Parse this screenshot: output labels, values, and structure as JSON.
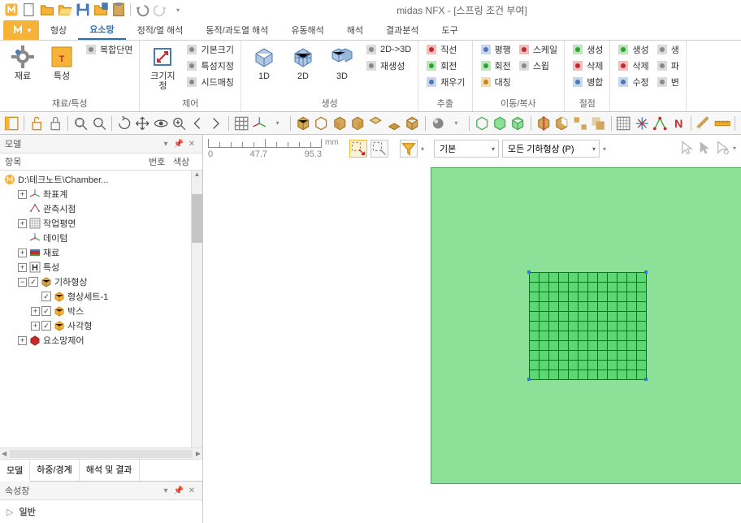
{
  "app": {
    "title": "midas NFX - [스프링 조건 부여]"
  },
  "qat": [
    "new",
    "open",
    "open-folder",
    "save",
    "duplicate",
    "paste",
    "separator",
    "undo",
    "redo",
    "dropdown"
  ],
  "tabs": {
    "file": "N",
    "items": [
      "형상",
      "요소망",
      "정적/열 해석",
      "동적/과도열 해석",
      "유동해석",
      "해석",
      "결과분석",
      "도구"
    ],
    "active": 1
  },
  "ribbon": {
    "groups": [
      {
        "title": "재료/특성",
        "big": [
          {
            "label": "재료",
            "icon": "gear"
          },
          {
            "label": "특성",
            "icon": "text-frame"
          }
        ],
        "mini": [
          {
            "label": "복합단면",
            "icon": "layers"
          }
        ]
      },
      {
        "title": "제어",
        "big": [
          {
            "label": "크기지정",
            "icon": "resize"
          }
        ],
        "mini": [
          {
            "label": "기본크기",
            "icon": "default-size"
          },
          {
            "label": "특성지정",
            "icon": "assign-prop"
          },
          {
            "label": "시드매칭",
            "icon": "seed-match"
          }
        ]
      },
      {
        "title": "생성",
        "big": [
          {
            "label": "1D",
            "icon": "cube1d"
          },
          {
            "label": "2D",
            "icon": "cube2d"
          },
          {
            "label": "3D",
            "icon": "cube3d"
          }
        ],
        "mini": [
          {
            "label": "2D->3D",
            "icon": "convert"
          },
          {
            "label": "재생성",
            "icon": "regen"
          }
        ]
      },
      {
        "title": "추출",
        "mini_cols": [
          [
            {
              "label": "직선",
              "icon": "line"
            },
            {
              "label": "회전",
              "icon": "rotate"
            },
            {
              "label": "채우기",
              "icon": "fill"
            }
          ]
        ]
      },
      {
        "title": "이동/복사",
        "mini_cols": [
          [
            {
              "label": "평행",
              "icon": "translate"
            },
            {
              "label": "회전",
              "icon": "rotate2"
            },
            {
              "label": "대칭",
              "icon": "mirror"
            }
          ],
          [
            {
              "label": "스케일",
              "icon": "scale"
            },
            {
              "label": "스윕",
              "icon": "sweep"
            }
          ]
        ]
      },
      {
        "title": "절점",
        "mini_cols": [
          [
            {
              "label": "생성",
              "icon": "node-create"
            },
            {
              "label": "삭제",
              "icon": "node-delete"
            },
            {
              "label": "병합",
              "icon": "node-merge"
            }
          ]
        ]
      },
      {
        "title": "",
        "mini_cols": [
          [
            {
              "label": "생성",
              "icon": "elem-create"
            },
            {
              "label": "삭제",
              "icon": "elem-delete"
            },
            {
              "label": "수정",
              "icon": "elem-modify"
            }
          ],
          [
            {
              "label": "생",
              "icon": "x1"
            },
            {
              "label": "파",
              "icon": "x2"
            },
            {
              "label": "변",
              "icon": "x3"
            }
          ]
        ]
      }
    ]
  },
  "panels": {
    "model": {
      "title": "모델"
    },
    "tree_cols": {
      "c1": "항목",
      "c2": "번호",
      "c3": "색상"
    },
    "tree": {
      "root": "D:\\테크노트\\Chamber...",
      "items": [
        {
          "label": "좌표계",
          "icon": "axis",
          "exp": "plus",
          "indent": 1
        },
        {
          "label": "관측시점",
          "icon": "eye",
          "exp": "none",
          "indent": 1
        },
        {
          "label": "작업평면",
          "icon": "plane",
          "exp": "plus",
          "indent": 1
        },
        {
          "label": "데이텀",
          "icon": "datum",
          "exp": "none",
          "indent": 1
        },
        {
          "label": "재료",
          "icon": "material",
          "exp": "plus",
          "indent": 1
        },
        {
          "label": "특성",
          "icon": "props",
          "exp": "plus",
          "indent": 1
        },
        {
          "label": "기하형상",
          "icon": "geom",
          "exp": "minus",
          "indent": 1,
          "check": true
        },
        {
          "label": "형상세트-1",
          "icon": "box",
          "exp": "none",
          "indent": 2,
          "check": true
        },
        {
          "label": "박스",
          "icon": "box",
          "exp": "plus",
          "indent": 2,
          "check": true
        },
        {
          "label": "사각형",
          "icon": "box",
          "exp": "plus",
          "indent": 2,
          "check": true
        },
        {
          "label": "요소망제어",
          "icon": "mesh",
          "exp": "plus",
          "indent": 1
        }
      ]
    },
    "side_tabs": [
      "모델",
      "하중/경계",
      "해석 및 결과"
    ],
    "props": {
      "title": "속성창",
      "section": "일반"
    }
  },
  "viewport": {
    "ruler": {
      "vals": [
        "0",
        "47.7",
        "95.3"
      ],
      "unit": "mm"
    },
    "dropdowns": {
      "d1": "기본",
      "d2": "모든 기하형상 (P)"
    }
  }
}
